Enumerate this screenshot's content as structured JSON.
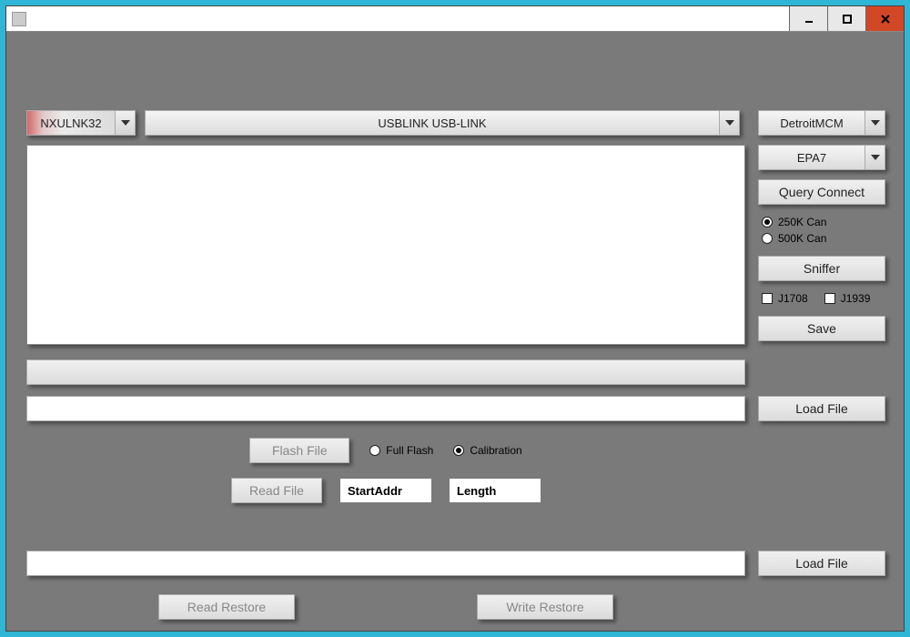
{
  "window": {
    "title": ""
  },
  "toolbar": {
    "driver_selected": "NXULNK32",
    "device_selected": "USBLINK USB-LINK"
  },
  "right": {
    "module_selected": "DetroitMCM",
    "variant_selected": "EPA7",
    "query_label": "Query Connect",
    "can_250": "250K Can",
    "can_500": "500K Can",
    "can_selected": "250K Can",
    "sniffer_label": "Sniffer",
    "chk_j1708": "J1708",
    "chk_j1939": "J1939",
    "save_label": "Save",
    "loadfile_label": "Load File"
  },
  "flash": {
    "button": "Flash File",
    "opt_full": "Full Flash",
    "opt_cal": "Calibration",
    "selected": "Calibration"
  },
  "read": {
    "button": "Read File",
    "start_label": "StartAddr",
    "length_label": "Length"
  },
  "restore": {
    "read": "Read Restore",
    "write": "Write Restore"
  }
}
